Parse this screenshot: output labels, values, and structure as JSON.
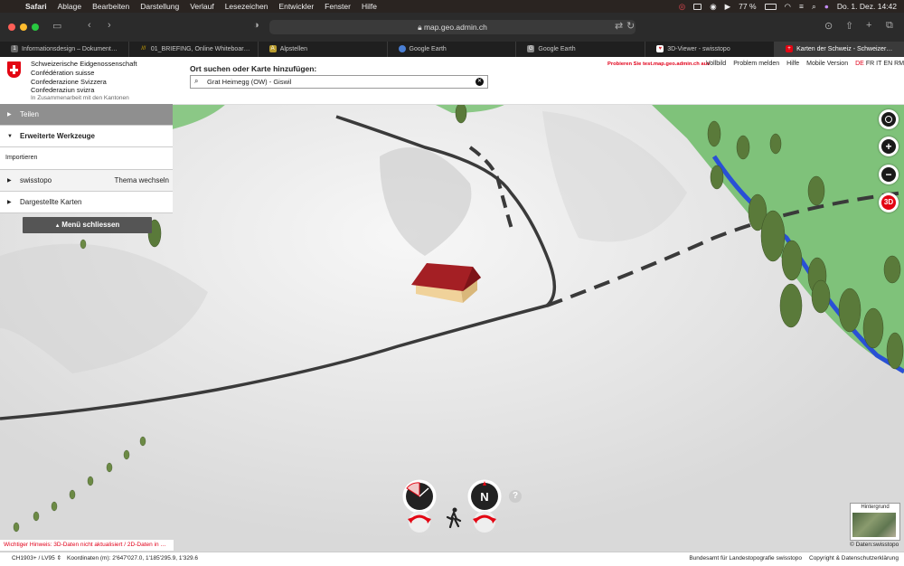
{
  "menubar": {
    "app": "Safari",
    "items": [
      "Ablage",
      "Bearbeiten",
      "Darstellung",
      "Verlauf",
      "Lesezeichen",
      "Entwickler",
      "Fenster",
      "Hilfe"
    ],
    "battery": "77 %",
    "datetime": "Do. 1. Dez. 14:42"
  },
  "browser": {
    "url": "map.geo.admin.ch",
    "tabs": [
      {
        "label": "Informationsdesign – Dokument…",
        "icon": "1",
        "icon_color": "#666666"
      },
      {
        "label": "01_BRIEFING, Online Whiteboar…",
        "icon": "///",
        "icon_color": "#c9a100"
      },
      {
        "label": "Alpstellen",
        "icon": "A",
        "icon_color": "#b89b2d"
      },
      {
        "label": "Google Earth",
        "icon": "",
        "icon_color": "#4a7fd4"
      },
      {
        "label": "Google Earth",
        "icon": "G",
        "icon_color": "#888888"
      },
      {
        "label": "3D-Viewer - swisstopo",
        "icon": "♥",
        "icon_color": "#d9262c"
      },
      {
        "label": "Karten der Schweiz - Schweizer…",
        "icon": "+",
        "icon_color": "#e30613"
      }
    ]
  },
  "header": {
    "confederation": [
      "Schweizerische Eidgenossenschaft",
      "Confédération suisse",
      "Confederazione Svizzera",
      "Confederaziun svizra"
    ],
    "collaboration": "In Zusammenarbeit mit den Kantonen",
    "search_title": "Ort suchen oder Karte hinzufügen:",
    "search_value": "Grat Heimegg (OW) - Giswil",
    "promo": "Probieren Sie test.map.geo.admin.ch aus",
    "links": [
      "Vollbild",
      "Problem melden",
      "Hilfe",
      "Mobile Version"
    ],
    "languages": [
      "DE",
      "FR",
      "IT",
      "EN",
      "RM"
    ],
    "active_language": "DE"
  },
  "panel": {
    "share": "Teilen",
    "advanced_tools": "Erweiterte Werkzeuge",
    "import": "Importieren",
    "topic": "swisstopo",
    "change_topic": "Thema wechseln",
    "displayed_maps": "Dargestellte Karten",
    "close_menu": "Menü schliessen"
  },
  "map": {
    "zoom_in_label": "+",
    "zoom_out_label": "−",
    "mode_label": "3D",
    "hint": "Wichtiger Hinweis: 3D-Daten nicht aktualisiert / 2D-Daten in …",
    "background_label": "Hintergrund",
    "data_credit": "© Daten:swisstopo",
    "help_label": "?",
    "colors": {
      "forest": "#7fc27a",
      "river": "#2950d6",
      "road": "#3a3a3a",
      "roof": "#a41f24"
    }
  },
  "footer": {
    "crs": "CH1903+ / LV95",
    "coordinates": "Koordinaten (m): 2'647'027.0, 1'185'295.9, 1'329.6",
    "agency": "Bundesamt für Landestopografie swisstopo",
    "copyright": "Copyright & Datenschutzerklärung"
  }
}
